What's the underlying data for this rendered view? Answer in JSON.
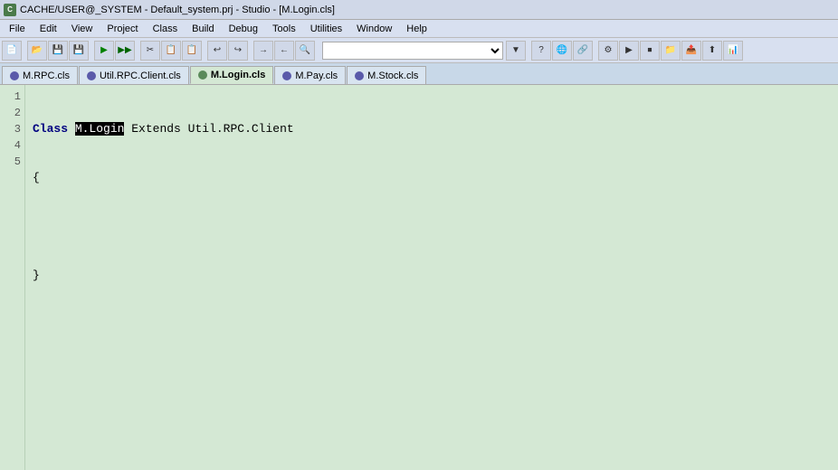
{
  "titleBar": {
    "text": "CACHE/USER@_SYSTEM - Default_system.prj - Studio - [M.Login.cls]",
    "icon": "C"
  },
  "menuBar": {
    "items": [
      "File",
      "Edit",
      "View",
      "Project",
      "Class",
      "Build",
      "Debug",
      "Tools",
      "Utilities",
      "Window",
      "Help"
    ]
  },
  "toolbar": {
    "dropdown": {
      "placeholder": ""
    }
  },
  "tabs": [
    {
      "label": "M.RPC.cls",
      "active": false,
      "iconColor": "blue"
    },
    {
      "label": "Util.RPC.Client.cls",
      "active": false,
      "iconColor": "blue"
    },
    {
      "label": "M.Login.cls",
      "active": true,
      "iconColor": "green"
    },
    {
      "label": "M.Pay.cls",
      "active": false,
      "iconColor": "blue"
    },
    {
      "label": "M.Stock.cls",
      "active": false,
      "iconColor": "blue"
    }
  ],
  "editor": {
    "lines": [
      {
        "num": 1,
        "code": "Class M.Login Extends Util.RPC.Client",
        "highlighted": "M.Login"
      },
      {
        "num": 2,
        "code": "{"
      },
      {
        "num": 3,
        "code": ""
      },
      {
        "num": 4,
        "code": "}"
      },
      {
        "num": 5,
        "code": ""
      }
    ]
  }
}
